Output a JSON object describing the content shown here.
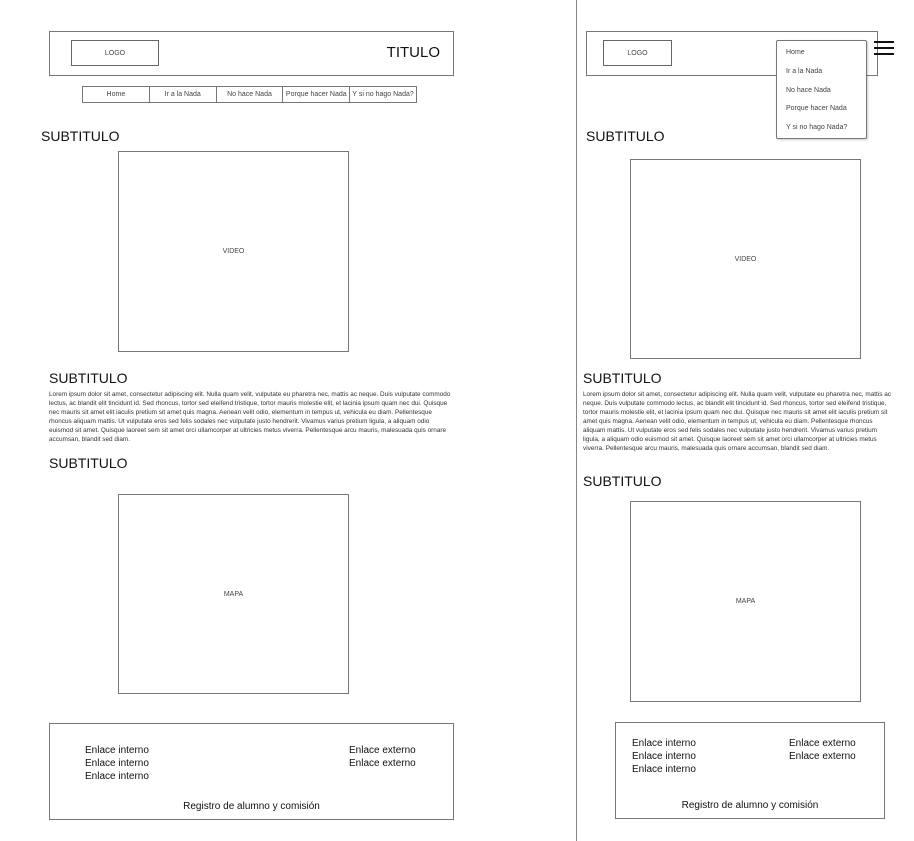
{
  "desktop": {
    "header": {
      "logo": "LOGO",
      "title": "TITULO"
    },
    "nav": [
      "Home",
      "Ir a la Nada",
      "No hace Nada",
      "Porque hacer Nada",
      "Y si no hago Nada?"
    ],
    "subtitles": [
      "SUBTITULO",
      "SUBTITULO",
      "SUBTITULO"
    ],
    "video_label": "VIDEO",
    "map_label": "MAPA",
    "lorem": "Lorem ipsum dolor sit amet, consectetur adipiscing elit. Nulla quam velit, vulputate eu pharetra nec, mattis ac neque. Duis vulputate commodo lectus, ac blandit elit tincidunt id. Sed rhoncus, tortor sed eleifend tristique, tortor mauris molestie elit, et lacinia ipsum quam nec dui. Quisque nec mauris sit amet elit iaculis pretium sit amet quis magna. Aenean velit odio, elementum in tempus ut, vehicula eu diam. Pellentesque rhoncus aliquam mattis. Ut vulputate eros sed felis sodales nec vulputate justo hendrerit. Vivamus varius pretium ligula, a aliquam odio euismod sit amet. Quisque laoreet sem sit amet orci ullamcorper at ultricies metus viverra. Pellentesque arcu mauris, malesuada quis ornare accumsan, blandit sed diam.",
    "footer": {
      "internal_links": [
        "Enlace interno",
        "Enlace interno",
        "Enlace interno"
      ],
      "external_links": [
        "Enlace externo",
        "Enlace externo"
      ],
      "registry": "Registro de alumno y comisión"
    }
  },
  "mobile": {
    "header": {
      "logo": "LOGO",
      "menu_icon": "hamburger-icon"
    },
    "menu": [
      "Home",
      "Ir a la Nada",
      "No hace Nada",
      "Porque hacer Nada",
      "Y si no hago Nada?"
    ],
    "subtitles": [
      "SUBTITULO",
      "SUBTITULO",
      "SUBTITULO"
    ],
    "video_label": "VIDEO",
    "map_label": "MAPA",
    "lorem": "Lorem ipsum dolor sit amet, consectetur adipiscing elit. Nulla quam velit, vulputate eu pharetra nec, mattis ac neque. Duis vulputate commodo lectus, ac blandit elit tincidunt id. Sed rhoncus, tortor sed eleifend tristique, tortor mauris molestie elit, et lacinia ipsum quam nec dui. Quisque nec mauris sit amet elit iaculis pretium sit amet quis magna. Aenean velit odio, elementum in tempus ut, vehicula eu diam. Pellentesque rhoncus aliquam mattis. Ut vulputate eros sed felis sodales nec vulputate justo hendrerit. Vivamus varius pretium ligula, a aliquam odio euismod sit amet. Quisque laoreet sem sit amet orci ullamcorper at ultricies metus viverra. Pellentesque arcu mauris, malesuada quis ornare accumsan, blandit sed diam.",
    "footer": {
      "internal_links": [
        "Enlace interno",
        "Enlace interno",
        "Enlace interno"
      ],
      "external_links": [
        "Enlace externo",
        "Enlace externo"
      ],
      "registry": "Registro de alumno y comisión"
    }
  }
}
